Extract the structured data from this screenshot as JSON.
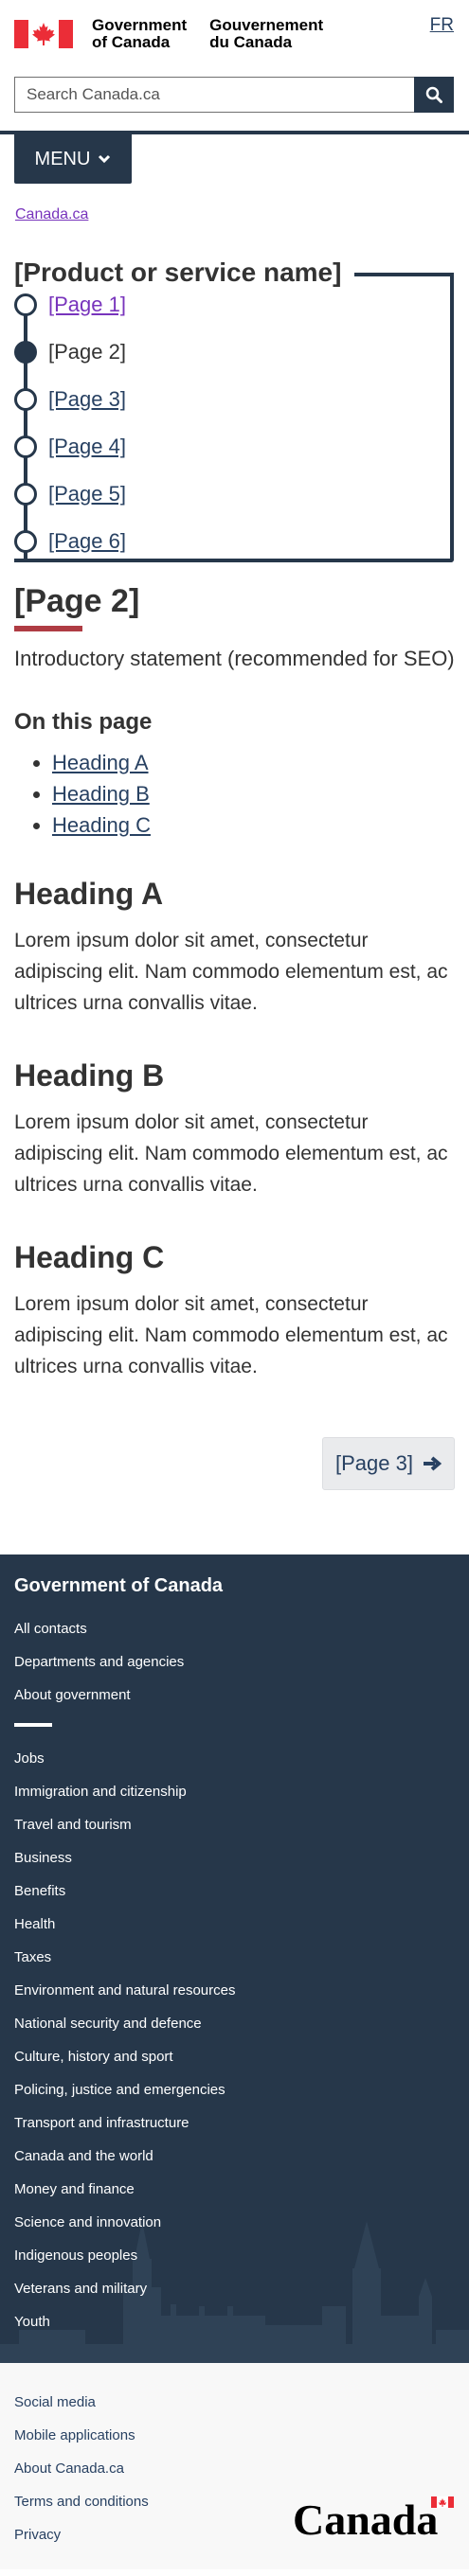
{
  "header": {
    "gov_en_line1": "Government",
    "gov_en_line2": "of Canada",
    "gov_fr_line1": "Gouvernement",
    "gov_fr_line2": "du Canada",
    "lang_toggle": "FR",
    "search_placeholder": "Search Canada.ca",
    "search_icon": "magnifier-icon",
    "flag_colors": {
      "red": "#eb2d37",
      "white": "#ffffff"
    }
  },
  "menu": {
    "label": "MENU",
    "icon": "chevron-down-icon"
  },
  "breadcrumb": {
    "items": [
      "Canada.ca"
    ]
  },
  "steps": {
    "title": "[Product or service name]",
    "items": [
      {
        "label": "[Page 1]",
        "state": "visited"
      },
      {
        "label": "[Page 2]",
        "state": "current"
      },
      {
        "label": "[Page 3]",
        "state": "link"
      },
      {
        "label": "[Page 4]",
        "state": "link"
      },
      {
        "label": "[Page 5]",
        "state": "link"
      },
      {
        "label": "[Page 6]",
        "state": "link"
      }
    ]
  },
  "content": {
    "title": "[Page 2]",
    "intro": "Introductory statement (recommended for SEO)",
    "on_this_page": "On this page",
    "toc": [
      "Heading A",
      "Heading B",
      "Heading C"
    ],
    "sections": [
      {
        "heading": "Heading A",
        "body": "Lorem ipsum dolor sit amet, consectetur adipiscing elit. Nam commodo elementum est, ac ultrices urna convallis vitae."
      },
      {
        "heading": "Heading B",
        "body": "Lorem ipsum dolor sit amet, consectetur adipiscing elit. Nam commodo elementum est, ac ultrices urna convallis vitae."
      },
      {
        "heading": "Heading C",
        "body": "Lorem ipsum dolor sit amet, consectetur adipiscing elit. Nam commodo elementum est, ac ultrices urna convallis vitae."
      }
    ],
    "next_button": "[Page 3]",
    "next_icon": "arrow-right-icon"
  },
  "footer": {
    "title": "Government of Canada",
    "primary_links": [
      "All contacts",
      "Departments and agencies",
      "About government"
    ],
    "topic_links": [
      "Jobs",
      "Immigration and citizenship",
      "Travel and tourism",
      "Business",
      "Benefits",
      "Health",
      "Taxes",
      "Environment and natural resources",
      "National security and defence",
      "Culture, history and sport",
      "Policing, justice and emergencies",
      "Transport and infrastructure",
      "Canada and the world",
      "Money and finance",
      "Science and innovation",
      "Indigenous peoples",
      "Veterans and military",
      "Youth"
    ],
    "bg_color": "#26374a"
  },
  "subfooter": {
    "links": [
      "Social media",
      "Mobile applications",
      "About Canada.ca",
      "Terms and conditions",
      "Privacy"
    ],
    "wordmark": "Canada"
  }
}
